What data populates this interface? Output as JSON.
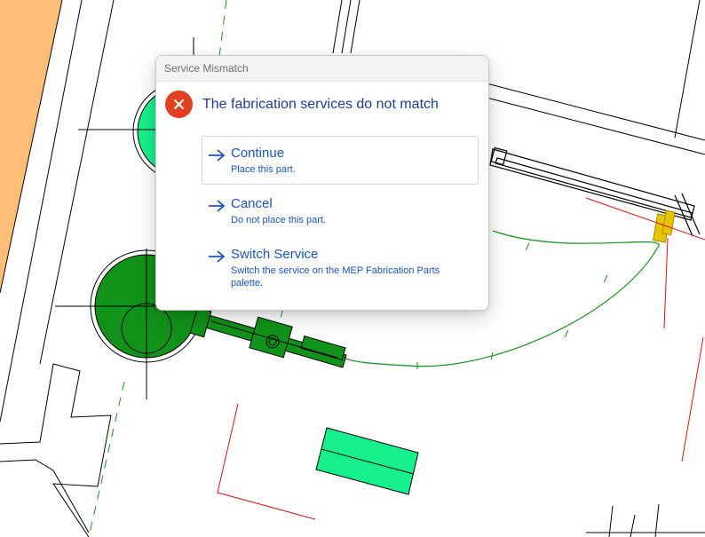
{
  "dialog": {
    "title": "Service Mismatch",
    "heading": "The fabrication services do not match",
    "icon": "error-icon",
    "options": [
      {
        "label": "Continue",
        "description": "Place this part.",
        "icon": "arrow-right-icon",
        "focused": true
      },
      {
        "label": "Cancel",
        "description": "Do not place this part.",
        "icon": "arrow-right-icon",
        "focused": false
      },
      {
        "label": "Switch Service",
        "description": "Switch the service on the MEP Fabrication Parts palette.",
        "icon": "arrow-right-icon",
        "focused": false
      }
    ]
  },
  "colors": {
    "accent_text": "#1a55b8",
    "heading_text": "#1f3c96",
    "error_icon": "#e0401f",
    "pipe_green": "#119319",
    "equipment_green": "#16f08c",
    "highlight_yellow": "#e6c400",
    "wall_orange": "#ffbe78",
    "reference_red": "#e01010"
  }
}
